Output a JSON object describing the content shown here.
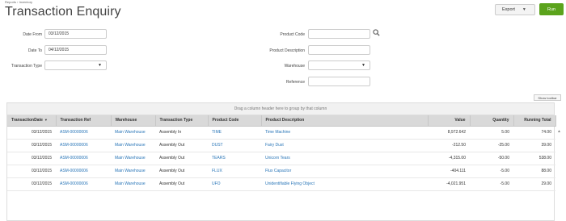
{
  "breadcrumb": {
    "parent": "Reports",
    "sep": " › ",
    "current": "Inventory"
  },
  "page_title": "Transaction Enquiry",
  "toolbar": {
    "export_label": "Export",
    "run_label": "Run"
  },
  "filters": {
    "date_from": {
      "label": "Date From",
      "value": "03/12/2015"
    },
    "date_to": {
      "label": "Date To",
      "value": "04/12/2015"
    },
    "transaction_type": {
      "label": "Transaction Type",
      "value": ""
    },
    "product_code": {
      "label": "Product Code",
      "value": ""
    },
    "product_description": {
      "label": "Product Description",
      "value": ""
    },
    "warehouse": {
      "label": "Warehouse",
      "value": ""
    },
    "reference": {
      "label": "Reference",
      "value": ""
    }
  },
  "show_toolbar_label": "Show toolbar",
  "group_hint": "Drag a column header here to group by that column",
  "table": {
    "columns": [
      "TransactionDate",
      "Transaction Ref",
      "Warehouse",
      "Transaction Type",
      "Product Code",
      "Product Description",
      "Value",
      "Quantity",
      "Running Total"
    ],
    "rows": [
      [
        "03/12/2015",
        "ASM-00000006",
        "Main Warehouse",
        "Assembly In",
        "TIME",
        "Time Machine",
        "8,972.642",
        "5.00",
        "74.00"
      ],
      [
        "03/12/2015",
        "ASM-00000006",
        "Main Warehouse",
        "Assembly Out",
        "DUST",
        "Fairy Dust",
        "-212.50",
        "-25.00",
        "39.00"
      ],
      [
        "03/12/2015",
        "ASM-00000006",
        "Main Warehouse",
        "Assembly Out",
        "TEARS",
        "Unicorn Tears",
        "-4,315.00",
        "-50.00",
        "538.00"
      ],
      [
        "03/12/2015",
        "ASM-00000006",
        "Main Warehouse",
        "Assembly Out",
        "FLUX",
        "Flux Capacitor",
        "-404.111",
        "-5.00",
        "88.00"
      ],
      [
        "03/12/2015",
        "ASM-00000006",
        "Main Warehouse",
        "Assembly Out",
        "UFO",
        "Unidentifiable Flying Object",
        "-4,021.951",
        "-5.00",
        "29.00"
      ]
    ]
  },
  "colors": {
    "run_button": "#5ba31c",
    "link": "#2a76b8",
    "header_bg": "#d9d9d9"
  },
  "icons": {
    "lookup": "search-icon",
    "sort": "sort-desc-icon",
    "dropdown": "chevron-down-icon"
  }
}
